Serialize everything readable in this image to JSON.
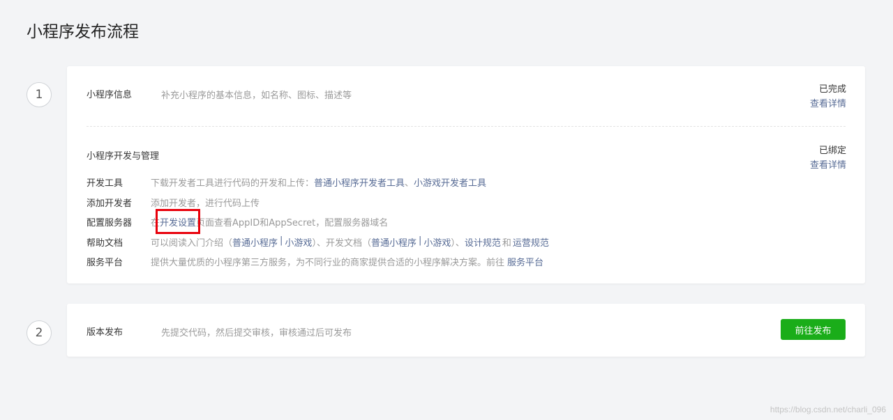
{
  "page": {
    "title": "小程序发布流程"
  },
  "steps": [
    {
      "number": "1"
    },
    {
      "number": "2"
    }
  ],
  "info_section": {
    "title": "小程序信息",
    "desc": "补充小程序的基本信息，如名称、图标、描述等",
    "status": "已完成",
    "link": "查看详情"
  },
  "dev_section": {
    "title": "小程序开发与管理",
    "status": "已绑定",
    "link": "查看详情",
    "tools": {
      "label": "开发工具",
      "text": "下载开发者工具进行代码的开发和上传：",
      "link1": "普通小程序开发者工具",
      "sep": "、",
      "link2": "小游戏开发者工具"
    },
    "add_dev": {
      "label": "添加开发者",
      "text": "添加开发者，进行代码上传"
    },
    "server": {
      "label": "配置服务器",
      "pre": "在",
      "link": "开发设置",
      "post": "页面查看AppID和AppSecret，配置服务器域名"
    },
    "docs": {
      "label": "帮助文档",
      "t1": "可以阅读入门介绍（",
      "l1": "普通小程序",
      "bar1": "|",
      "l2": "小游戏",
      "t2": "）、开发文档（",
      "l3": "普通小程序",
      "bar2": "|",
      "l4": "小游戏",
      "t3": "）、",
      "l5": "设计规范",
      "t4": "和",
      "l6": "运营规范"
    },
    "platform": {
      "label": "服务平台",
      "text": "提供大量优质的小程序第三方服务，为不同行业的商家提供合适的小程序解决方案。前往",
      "link": "服务平台"
    }
  },
  "release_section": {
    "title": "版本发布",
    "desc": "先提交代码，然后提交审核，审核通过后可发布",
    "button": "前往发布"
  },
  "watermark": "https://blog.csdn.net/charli_096",
  "colors": {
    "link": "#576b95",
    "primary": "#1aad19",
    "highlight": "#e8000b"
  }
}
